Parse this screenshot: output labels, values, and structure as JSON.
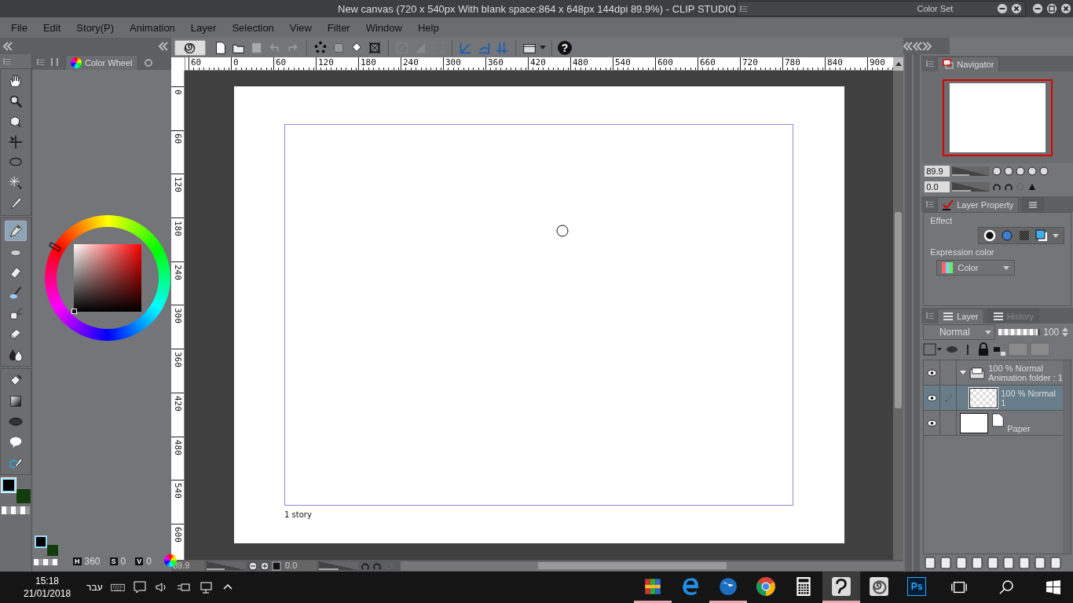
{
  "title_bar": {
    "title": "New canvas (720 x 540px With blank space:864 x 648px 144dpi 89.9%)  - CLIP STUDIO"
  },
  "color_set_palette": {
    "title": "Color Set"
  },
  "menu": [
    "File",
    "Edit",
    "Story(P)",
    "Animation",
    "Layer",
    "Selection",
    "View",
    "Filter",
    "Window",
    "Help"
  ],
  "toolbar": {
    "help_label": "?"
  },
  "tool_groups": [
    [
      {
        "selected": false
      },
      {
        "selected": false
      },
      {
        "selected": false
      },
      {
        "selected": false
      },
      {
        "selected": false
      },
      {
        "selected": false
      },
      {
        "selected": false
      }
    ],
    [
      {
        "selected": true
      },
      {
        "selected": false
      },
      {
        "selected": false
      },
      {
        "selected": false
      },
      {
        "selected": false
      },
      {
        "selected": false
      },
      {
        "selected": false
      }
    ],
    [
      {
        "selected": false
      },
      {
        "selected": false
      },
      {
        "selected": false
      },
      {
        "selected": false
      },
      {
        "selected": false
      }
    ]
  ],
  "swatches": [
    {
      "color": "#000000",
      "selected": true
    },
    {
      "color": "#123c0b",
      "selected": false
    }
  ],
  "color_panel": {
    "tab": "Color Wheel",
    "hsv": [
      {
        "label": "H",
        "value": "360"
      },
      {
        "label": "S",
        "value": "0"
      },
      {
        "label": "V",
        "value": "0"
      }
    ]
  },
  "ruler": {
    "horizontal": [
      "60",
      "0",
      "60",
      "120",
      "180",
      "240",
      "300",
      "360",
      "420",
      "480",
      "540",
      "600",
      "660",
      "720",
      "780",
      "840",
      "900"
    ],
    "vertical": [
      "0",
      "60",
      "120",
      "180",
      "240",
      "300",
      "360",
      "420",
      "480",
      "540",
      "600"
    ]
  },
  "canvas": {
    "story_label": "1 story"
  },
  "status_bar": {
    "zoom": "89.9",
    "zoom_slider": {
      "level": 0.45
    },
    "rotation": "0.0",
    "rotation_slider": {
      "level": 0.5
    }
  },
  "navigator": {
    "tab": "Navigator",
    "zoom": "89.9",
    "zoom_slider": {
      "level": 0.45
    },
    "rotation": "0.0",
    "rotation_slider": {
      "level": 0.5
    }
  },
  "layer_property": {
    "tab": "Layer Property",
    "effect_label": "Effect",
    "expression_label": "Expression color",
    "expression_value": "Color"
  },
  "layer_panel": {
    "tabs": [
      {
        "label": "Layer",
        "selected": true
      },
      {
        "label": "History",
        "selected": false
      }
    ],
    "blend_mode": "Normal",
    "opacity_slider": {
      "level": 1
    },
    "opacity": "100",
    "layers": [
      {
        "kind": "folder",
        "line1": "100 % Normal",
        "line2": "Animation folder : 1",
        "visible": true,
        "selected": false,
        "expanded": true,
        "children": [
          {
            "kind": "raster",
            "line1": "100 % Normal",
            "line2": "1",
            "visible": true,
            "selected": true
          }
        ]
      },
      {
        "kind": "paper",
        "line1": "Paper",
        "visible": true,
        "selected": false
      }
    ]
  },
  "taskbar": {
    "time": "15:18",
    "date": "21/01/2018",
    "language": "עבר",
    "apps": [
      {
        "kind": "archive",
        "running": true,
        "active": false
      },
      {
        "kind": "edge",
        "running": false,
        "active": false
      },
      {
        "kind": "globe",
        "running": true,
        "active": false
      },
      {
        "kind": "chrome",
        "running": false,
        "active": false
      },
      {
        "kind": "calculator",
        "running": false,
        "active": false
      },
      {
        "kind": "clip-paint",
        "running": true,
        "active": true
      },
      {
        "kind": "clip-studio",
        "running": false,
        "active": false
      },
      {
        "kind": "photoshop",
        "label": "Ps",
        "running": false,
        "active": false
      }
    ]
  }
}
